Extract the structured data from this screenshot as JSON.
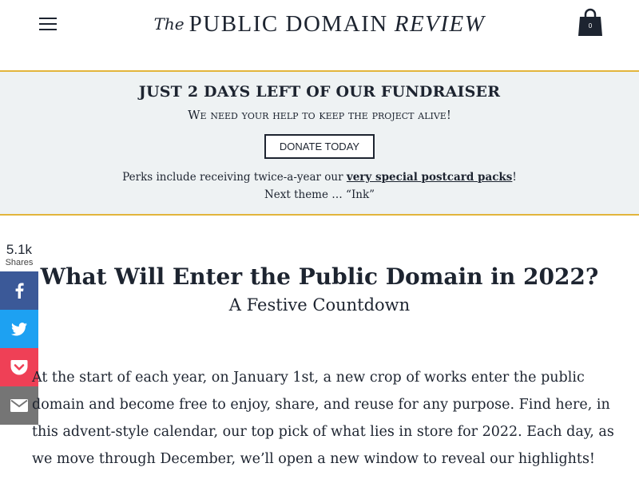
{
  "header": {
    "menu_icon": "hamburger-menu-icon",
    "logo": {
      "the": "The",
      "main": "PUBLIC DOMAIN",
      "review": "REVIEW"
    },
    "cart": {
      "icon": "shopping-bag-icon",
      "count": "0"
    }
  },
  "banner": {
    "title": "JUST 2 DAYS LEFT OF OUR FUNDRAISER",
    "subtitle": "We need your help to keep the project alive!",
    "donate_label": "DONATE TODAY",
    "perks_prefix": "Perks include receiving twice-a-year our ",
    "perks_link": "very special postcard packs",
    "perks_suffix": "!",
    "next_theme": "Next theme … “Ink”",
    "colors": {
      "background": "#eef2f3",
      "border": "#e2b53b"
    }
  },
  "share": {
    "count": "5.1k",
    "label": "Shares",
    "buttons": [
      {
        "network": "facebook",
        "icon": "facebook-icon",
        "color": "#3b5998"
      },
      {
        "network": "twitter",
        "icon": "twitter-icon",
        "color": "#1da1f2"
      },
      {
        "network": "pocket",
        "icon": "pocket-icon",
        "color": "#ef4056"
      },
      {
        "network": "email",
        "icon": "email-icon",
        "color": "#757575"
      }
    ]
  },
  "article": {
    "title": "What Will Enter the Public Domain in 2022?",
    "subtitle": "A Festive Countdown",
    "body": "At the start of each year, on January 1st, a new crop of works enter the public domain and become free to enjoy, share, and reuse for any purpose. Find here, in this advent-style calendar, our top pick of what lies in store for 2022. Each day, as we move through December, we’ll open a new window to reveal our highlights!"
  }
}
